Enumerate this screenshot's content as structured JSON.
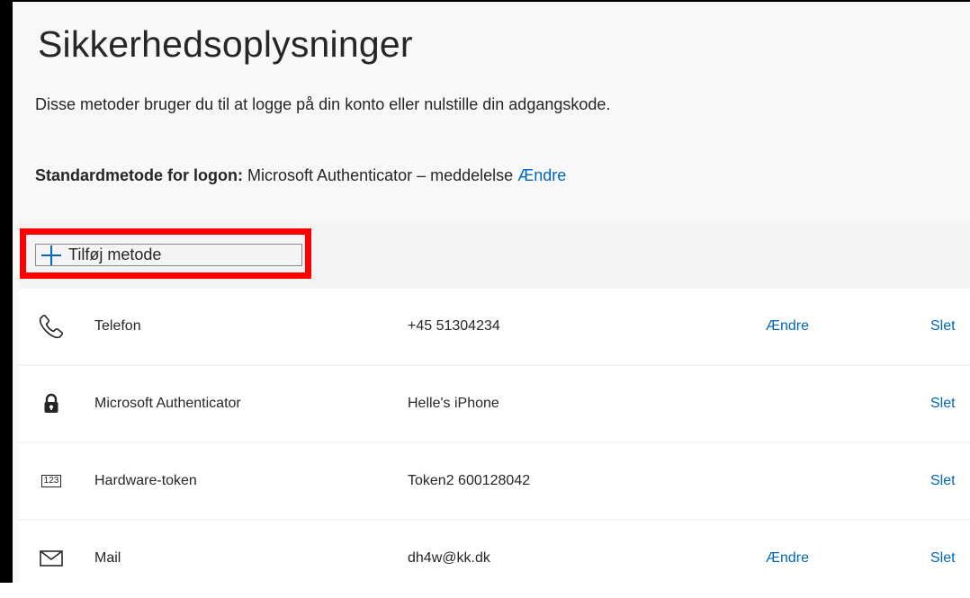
{
  "page": {
    "title": "Sikkerhedsoplysninger",
    "subtitle": "Disse metoder bruger du til at logge på din konto eller nulstille din adgangskode.",
    "default_method_label": "Standardmetode for logon:",
    "default_method_value": "Microsoft Authenticator – meddelelse",
    "default_method_change": "Ændre"
  },
  "add_method": {
    "label": "Tilføj metode",
    "icon": "plus-icon",
    "highlight_color": "#ff0000"
  },
  "methods": [
    {
      "icon": "phone-icon",
      "name": "Telefon",
      "detail": "+45 51304234",
      "change": "Ændre",
      "delete": "Slet"
    },
    {
      "icon": "authenticator-lock-icon",
      "name": "Microsoft Authenticator",
      "detail": "Helle's iPhone",
      "change": "",
      "delete": "Slet"
    },
    {
      "icon": "hardware-token-icon",
      "icon_text": "123",
      "name": "Hardware-token",
      "detail": "Token2 600128042",
      "change": "",
      "delete": "Slet"
    },
    {
      "icon": "mail-icon",
      "name": "Mail",
      "detail": "dh4w@kk.dk",
      "change": "Ændre",
      "delete": "Slet"
    }
  ],
  "colors": {
    "link": "#0067b8",
    "text": "#262626",
    "panel_bg": "#f4f4f4"
  }
}
